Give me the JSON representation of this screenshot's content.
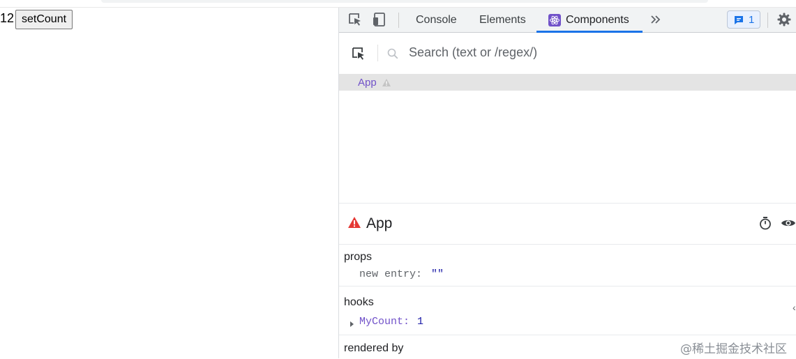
{
  "page": {
    "count": "12",
    "button_label": "setCount"
  },
  "devtools": {
    "tabs": [
      "Console",
      "Elements",
      "Components"
    ],
    "active_tab": "Components",
    "issues_count": "1",
    "icons": [
      "select-element-icon",
      "device-toggle-icon",
      "react-icon",
      "more-tabs-icon",
      "issues-icon",
      "gear-icon"
    ]
  },
  "components": {
    "search_placeholder": "Search (text or /regex/)",
    "tree": [
      {
        "label": "App",
        "warning": true
      }
    ]
  },
  "inspector": {
    "title": "App",
    "props_label": "props",
    "props": [
      {
        "key": "new entry",
        "value": "\"\""
      }
    ],
    "hooks_label": "hooks",
    "hooks": [
      {
        "key": "MyCount",
        "value": "1"
      }
    ],
    "rendered_by_label": "rendered by"
  },
  "watermark": "@稀土掘金技术社区",
  "colors": {
    "accent": "#1a73e8",
    "component": "#7152c9",
    "warning": "#e53935"
  }
}
